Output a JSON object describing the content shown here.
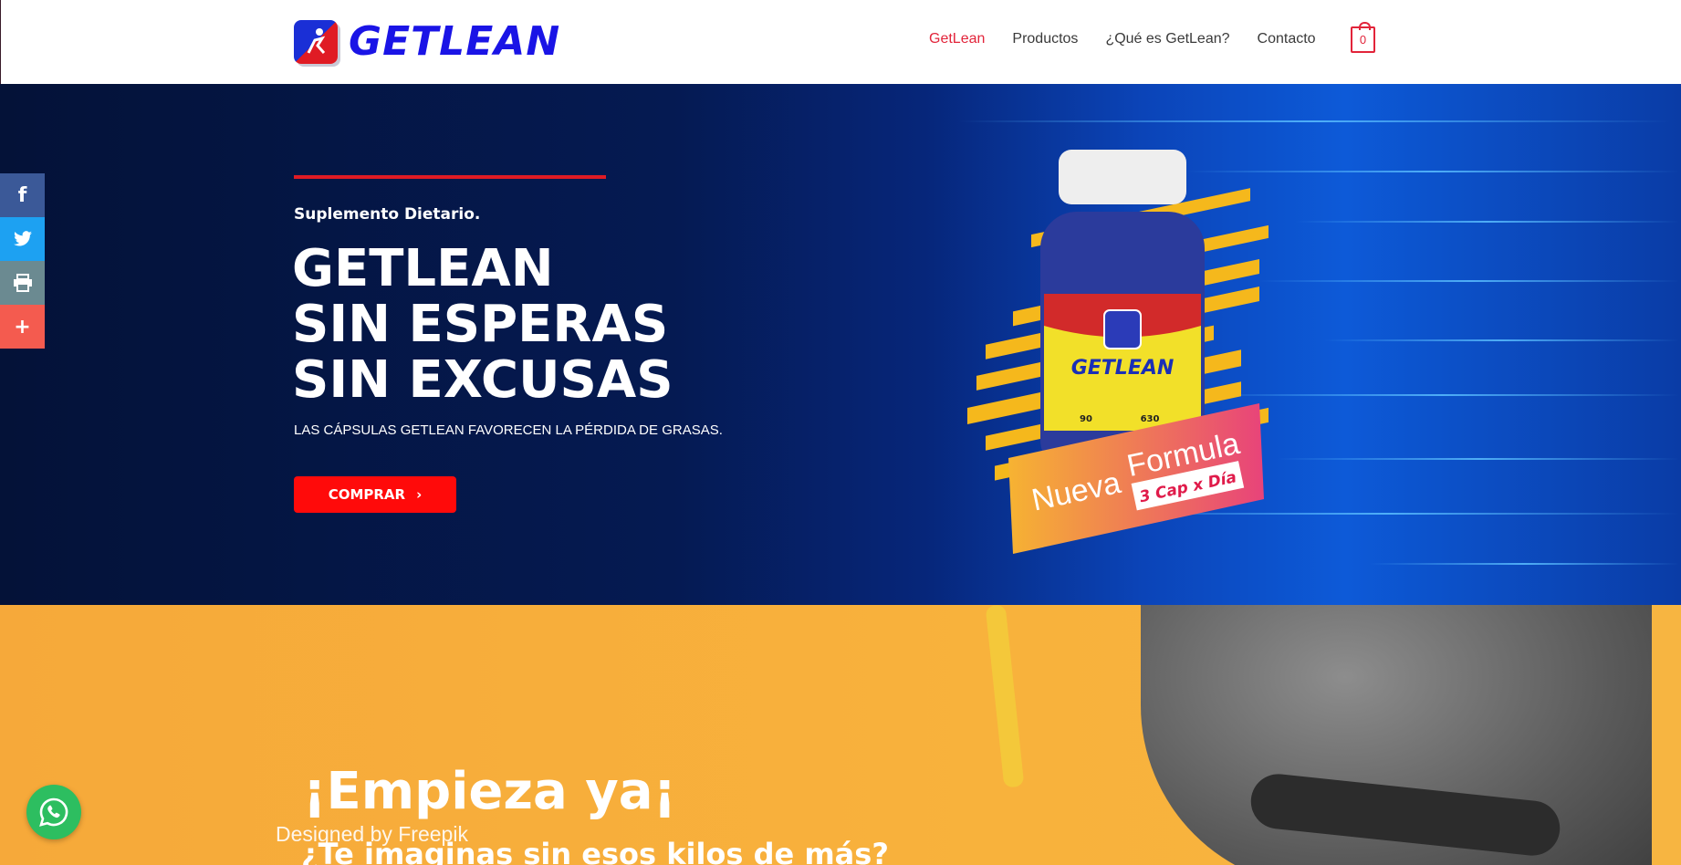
{
  "header": {
    "logo_text": "GETLEAN",
    "nav": [
      "GetLean",
      "Productos",
      "¿Qué es GetLean?",
      "Contacto"
    ],
    "active_nav": "GetLean",
    "cart_count": "0"
  },
  "social": {
    "icons": [
      "facebook-icon",
      "twitter-icon",
      "print-icon",
      "plus-icon"
    ]
  },
  "hero": {
    "kicker": "Suplemento Dietario.",
    "title_lines": [
      "GETLEAN",
      "SIN ESPERAS",
      "SIN EXCUSAS"
    ],
    "subtitle": "LAS CÁPSULAS GETLEAN FAVORECEN LA PÉRDIDA DE GRASAS.",
    "button_label": "COMPRAR",
    "product": {
      "brand": "GETLEAN",
      "badge_line1": "Nueva",
      "badge_line2": "Formula",
      "badge_line3": "3 Cap x Día",
      "count": "90",
      "mg": "630"
    }
  },
  "section2": {
    "title": "¡Empieza ya¡",
    "credit": "Designed by Freepik",
    "subtitle": "¿Te imaginas sin esos kilos de más?"
  },
  "colors": {
    "accent": "#e2243a",
    "logo_blue": "#1a14e6",
    "button_red": "#ff0a0a",
    "hero_dark": "#041238",
    "yellow": "#f8b23c"
  }
}
